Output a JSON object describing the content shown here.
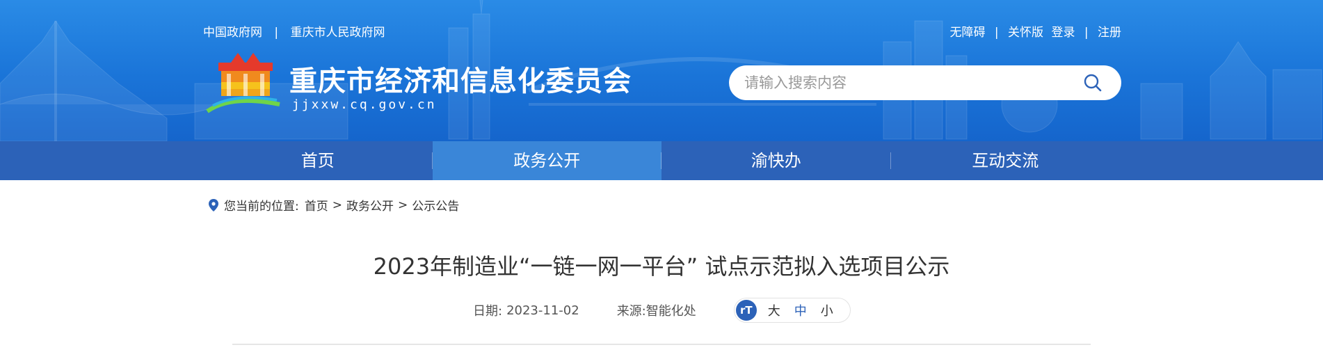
{
  "header": {
    "top_links": [
      "中国政府网",
      "重庆市人民政府网"
    ],
    "top_sep": "|",
    "right_links": [
      "无障碍",
      "关怀版",
      "登录",
      "注册"
    ],
    "site_title": "重庆市经济和信息化委员会",
    "site_domain": "jjxxw.cq.gov.cn",
    "search_placeholder": "请输入搜索内容"
  },
  "nav": {
    "items": [
      "首页",
      "政务公开",
      "渝快办",
      "互动交流"
    ],
    "active": "政务公开"
  },
  "breadcrumb": {
    "prefix": "您当前的位置:",
    "items": [
      "首页",
      "政务公开",
      "公示公告"
    ],
    "arrow": ">"
  },
  "article": {
    "title": "2023年制造业“一链一网一平台” 试点示范拟入选项目公示",
    "date_label": "日期:",
    "date": "2023-11-02",
    "source_label": "来源:",
    "source": "智能化处",
    "fontsize_icon": "rT",
    "fontsize_options": [
      "大",
      "中",
      "小"
    ]
  },
  "colors": {
    "banner": "#1a74d8",
    "nav": "#2c62b8",
    "nav_active": "#3a86d8"
  }
}
